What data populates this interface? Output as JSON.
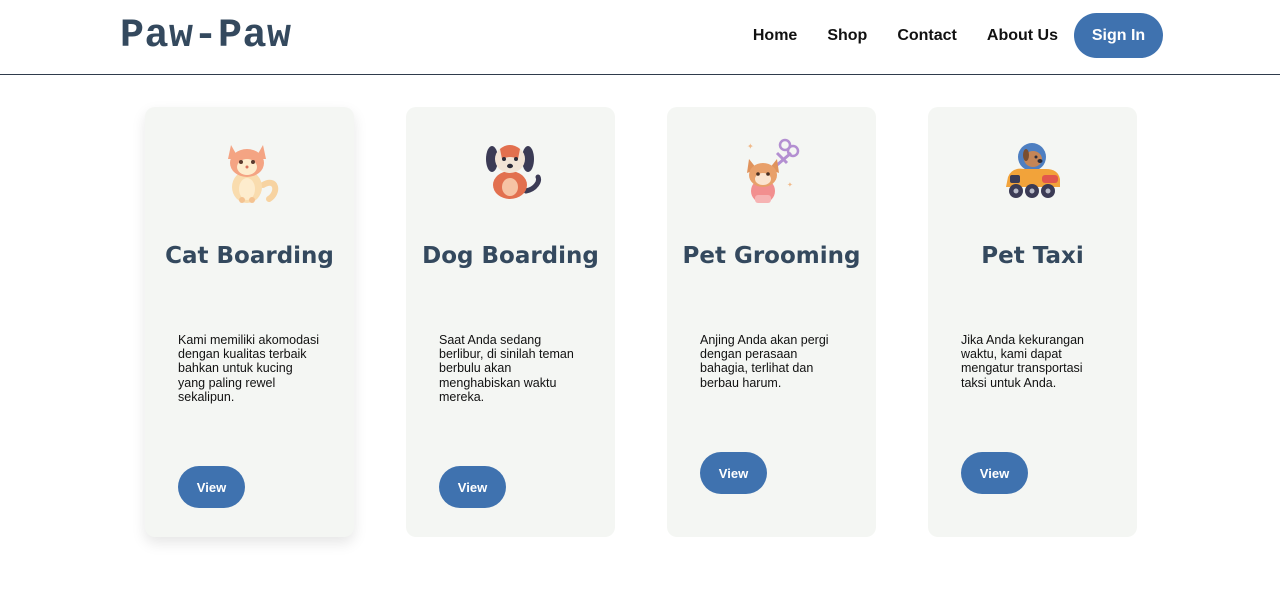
{
  "header": {
    "logo": "Paw-Paw",
    "nav": [
      "Home",
      "Shop",
      "Contact",
      "About Us"
    ],
    "signin_label": "Sign In"
  },
  "colors": {
    "accent": "#3f72af",
    "heading": "#34495e",
    "card_bg": "#f4f6f3"
  },
  "cards": [
    {
      "icon": "cat-icon",
      "title": "Cat Boarding",
      "description": "Kami memiliki akomodasi dengan kualitas terbaik bahkan untuk kucing yang paling rewel sekalipun.",
      "button": "View"
    },
    {
      "icon": "dog-icon",
      "title": "Dog Boarding",
      "description": "Saat Anda sedang berlibur, di sinilah teman berbulu akan menghabiskan waktu mereka.",
      "button": "View"
    },
    {
      "icon": "grooming-icon",
      "title": "Pet Grooming",
      "description": "Anjing Anda akan pergi dengan perasaan bahagia, terlihat dan berbau harum.",
      "button": "View"
    },
    {
      "icon": "pet-taxi-icon",
      "title": "Pet Taxi",
      "description": "Jika Anda kekurangan waktu, kami dapat mengatur transportasi taksi untuk Anda.",
      "button": "View"
    }
  ]
}
